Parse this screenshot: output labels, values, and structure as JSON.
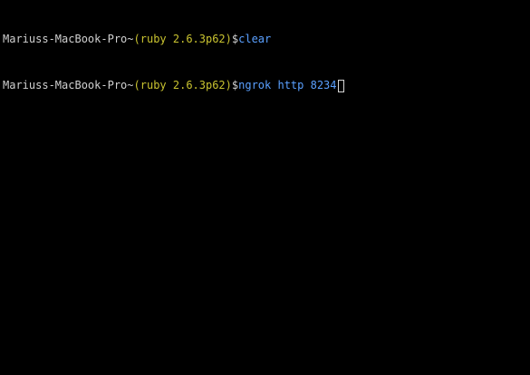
{
  "terminal": {
    "lines": [
      {
        "host": "Mariuss-MacBook-Pro",
        "dir": "~",
        "env": "(ruby 2.6.3p62)",
        "prompt": "$",
        "command": "clear"
      },
      {
        "host": "Mariuss-MacBook-Pro",
        "dir": "~",
        "env": "(ruby 2.6.3p62)",
        "prompt": "$",
        "command": "ngrok http 8234"
      }
    ]
  },
  "colors": {
    "background": "#000000",
    "text": "#d0d0d0",
    "env": "#c9c330",
    "command": "#5aa0ff"
  }
}
